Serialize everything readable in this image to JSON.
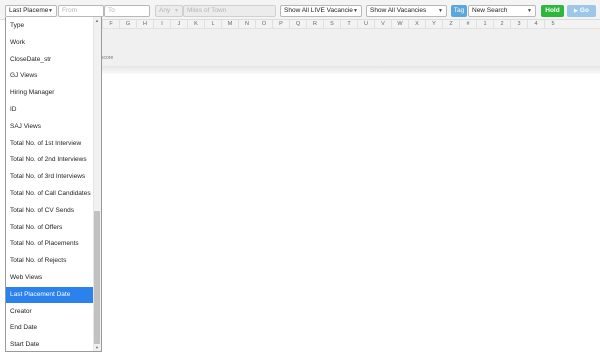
{
  "toolbar": {
    "field_select": "Last Placeme",
    "from_placeholder": "From",
    "to_placeholder": "To",
    "any_select": "Any",
    "miles_placeholder": "Miles of Town",
    "vacancy_filter": "Show All LIVE Vacancie",
    "vacancy_scope": "Show All Vacancies",
    "tag_label": "Tag",
    "search_select": "New Search",
    "hold_label": "Hold",
    "go_label": "Go"
  },
  "alphabet": [
    "F",
    "G",
    "H",
    "I",
    "J",
    "K",
    "L",
    "M",
    "N",
    "O",
    "P",
    "Q",
    "R",
    "S",
    "T",
    "U",
    "V",
    "W",
    "X",
    "Y",
    "Z",
    "#",
    "1",
    "2",
    "3",
    "4",
    "5"
  ],
  "band": {
    "score_label": "score"
  },
  "dropdown": {
    "items": [
      "Type",
      "Work",
      "CloseDate_str",
      "GJ Views",
      "Hiring Manager",
      "ID",
      "SAJ Views",
      "Total No. of 1st Interview",
      "Total No. of 2nd Interviews",
      "Total No. of 3rd Interviews",
      "Total No. of Call Candidates",
      "Total No. of CV Sends",
      "Total No. of Offers",
      "Total No. of Placements",
      "Total No. of Rejects",
      "Web Views",
      "Last Placement Date",
      "Creator",
      "End Date",
      "Start Date"
    ],
    "selected": "Last Placement Date"
  },
  "icons": {
    "caret": "caret-down-icon",
    "play": "play-icon",
    "scroll_up": "scroll-up-arrow-icon",
    "scroll_down": "scroll-down-arrow-icon"
  },
  "colors": {
    "selected_item": "#2b82ed",
    "hold_button": "#2db83d",
    "go_button": "#9cc7ea",
    "tag_button": "#5aa7dd"
  }
}
